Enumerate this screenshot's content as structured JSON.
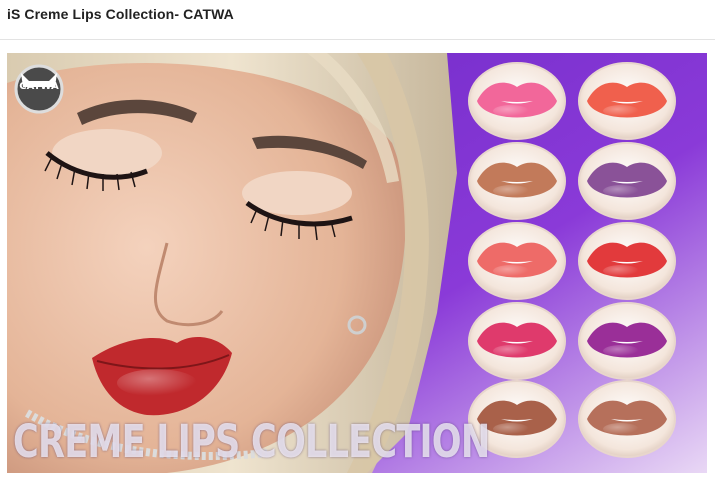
{
  "post": {
    "title": "iS Creme Lips Collection- CATWA"
  },
  "image": {
    "brand_logo_text": "CATWA",
    "banner_text": "CREME LIPS COLLECTION",
    "swatches": [
      {
        "shade": "pink",
        "color": "#f2679a"
      },
      {
        "shade": "coral",
        "color": "#f0604d"
      },
      {
        "shade": "tan-nude",
        "color": "#c27a5a"
      },
      {
        "shade": "mauve-purple",
        "color": "#8a5298"
      },
      {
        "shade": "salmon",
        "color": "#ee6b68"
      },
      {
        "shade": "red",
        "color": "#e23a3c"
      },
      {
        "shade": "raspberry",
        "color": "#df3a6c"
      },
      {
        "shade": "magenta-purple",
        "color": "#9a2f98"
      },
      {
        "shade": "brown-nude",
        "color": "#a9614a"
      },
      {
        "shade": "warm-nude",
        "color": "#b6705b"
      }
    ],
    "model_lip_color": "#c0292d",
    "background_color": "#7a2fd0"
  }
}
